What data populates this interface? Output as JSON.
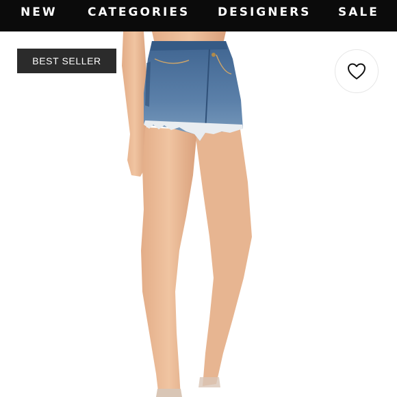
{
  "nav": {
    "items": [
      {
        "label": "NEW"
      },
      {
        "label": "CATEGORIES"
      },
      {
        "label": "DESIGNERS"
      },
      {
        "label": "SALE"
      }
    ]
  },
  "product": {
    "badge": "BEST SELLER",
    "favorite_icon": "heart-outline-icon",
    "image_subject": "model wearing distressed denim cutoff shorts"
  },
  "colors": {
    "nav_background": "#0b0b0b",
    "badge_background": "#2b2b2b",
    "denim": "#4a6e98"
  }
}
